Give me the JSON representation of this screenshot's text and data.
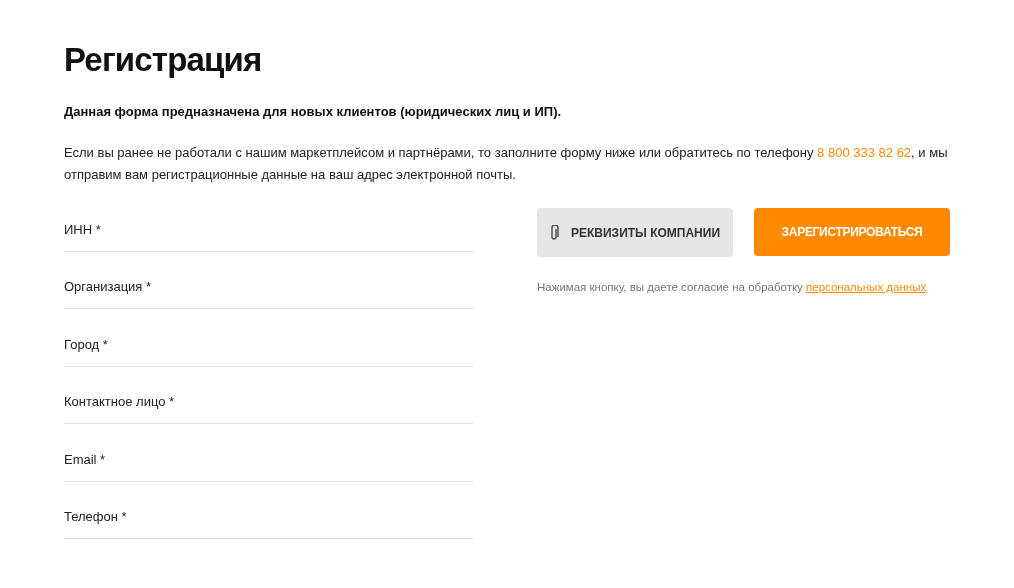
{
  "title": "Регистрация",
  "notice": "Данная форма предназначена для новых клиентов (юридических лиц и ИП).",
  "intro": {
    "before": "Если вы ранее не работали с нашим маркетплейсом и партнёрами, то заполните форму ниже или обратитесь по телефону ",
    "phone": "8 800 333 82 62",
    "after": ", и мы отправим вам регистрационные данные на ваш адрес электронной почты."
  },
  "fields": [
    {
      "placeholder": "ИНН *"
    },
    {
      "placeholder": "Организация *"
    },
    {
      "placeholder": "Город *"
    },
    {
      "placeholder": "Контактное лицо *"
    },
    {
      "placeholder": "Email *"
    },
    {
      "placeholder": "Телефон *"
    }
  ],
  "buttons": [
    {
      "kind": "attach",
      "label": "РЕКВИЗИТЫ КОМПАНИИ"
    },
    {
      "kind": "primary",
      "label": "ЗАРЕГИСТРИРОВАТЬСЯ"
    }
  ],
  "consent": {
    "text": "Нажимая кнопку, вы даете согласие на обработку ",
    "link": "персональных данных"
  }
}
